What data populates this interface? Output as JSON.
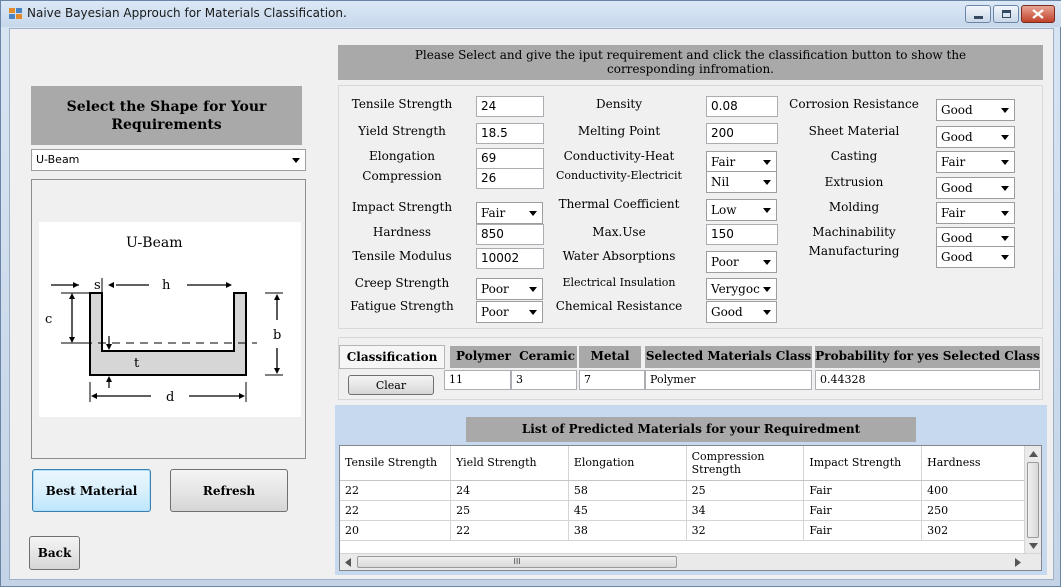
{
  "window": {
    "title": "Naive Bayesian Approuch for Materials Classification."
  },
  "left": {
    "heading": "Select the Shape  for Your Requirements",
    "shape_select": "U-Beam",
    "diagram": {
      "title": "U-Beam",
      "labels": {
        "s": "s",
        "h": "h",
        "c": "c",
        "b": "b",
        "t": "t",
        "d": "d"
      }
    },
    "best_button": "Best Material",
    "refresh_button": "Refresh",
    "back_button": "Back"
  },
  "instruction": "Please Select and give the iput requirement and click the classification button to show the corresponding infromation.",
  "form": {
    "col1": [
      {
        "label": "Tensile Strength",
        "value": "24",
        "kind": "input"
      },
      {
        "label": "Yield Strength",
        "value": "18.5",
        "kind": "input"
      },
      {
        "label": "Elongation",
        "value": "69",
        "kind": "input"
      },
      {
        "label": "Compression",
        "value": "26",
        "kind": "input"
      },
      {
        "label": "Impact Strength",
        "value": "Fair",
        "kind": "combo"
      },
      {
        "label": "Hardness",
        "value": "850",
        "kind": "input"
      },
      {
        "label": "Tensile Modulus",
        "value": "10002",
        "kind": "input"
      },
      {
        "label": "Creep Strength",
        "value": "Poor",
        "kind": "combo"
      },
      {
        "label": "Fatigue Strength",
        "value": "Poor",
        "kind": "combo"
      }
    ],
    "col2": [
      {
        "label": "Density",
        "value": "0.08",
        "kind": "input"
      },
      {
        "label": "Melting Point",
        "value": "200",
        "kind": "input"
      },
      {
        "label": "Conductivity-Heat",
        "value": "Fair",
        "kind": "combo"
      },
      {
        "label": "Conductivity-Electricit",
        "value": "Nil",
        "kind": "combo"
      },
      {
        "label": "Thermal Coefficient",
        "value": "Low",
        "kind": "combo"
      },
      {
        "label": "Max.Use",
        "value": "150",
        "kind": "input"
      },
      {
        "label": "Water Absorptions",
        "value": "Poor",
        "kind": "combo"
      },
      {
        "label": "Electrical Insulation",
        "value": "Verygoc",
        "kind": "combo"
      },
      {
        "label": "Chemical Resistance",
        "value": "Good",
        "kind": "combo"
      }
    ],
    "col3": [
      {
        "label": "Corrosion Resistance",
        "value": "Good"
      },
      {
        "label": "Sheet Material",
        "value": "Good"
      },
      {
        "label": "Casting",
        "value": "Fair"
      },
      {
        "label": "Extrusion",
        "value": "Good"
      },
      {
        "label": "Molding",
        "value": "Fair"
      },
      {
        "label": "Machinability",
        "value": "Good"
      },
      {
        "label": "Manufacturing",
        "value": "Good"
      }
    ]
  },
  "classification": {
    "classify_button": "Classification",
    "clear_button": "Clear",
    "headers": {
      "polymer": "Polymer",
      "ceramic": "Ceramic",
      "metal": "Metal",
      "selected_class": "Selected Materials Class",
      "probability": "Probability for  yes Selected Class"
    },
    "values": {
      "polymer": "11",
      "ceramic": "3",
      "metal": "7",
      "selected_class": "Polymer",
      "probability": "0.44328"
    }
  },
  "list": {
    "heading": "List of Predicted Materials for  your Requiredment",
    "columns": [
      "Tensile Strength",
      "Yield Strength",
      "Elongation",
      "Compression Strength",
      "Impact Strength",
      "Hardness"
    ],
    "rows": [
      [
        "22",
        "24",
        "58",
        "25",
        "Fair",
        "400"
      ],
      [
        "22",
        "25",
        "45",
        "34",
        "Fair",
        "250"
      ],
      [
        "20",
        "22",
        "38",
        "32",
        "Fair",
        "302"
      ]
    ],
    "scroll_grip": "III"
  }
}
